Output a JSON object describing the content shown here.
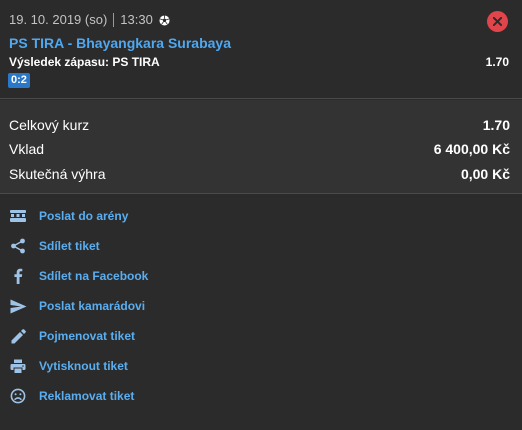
{
  "ticket": {
    "date": "19. 10. 2019 (so)",
    "time": "13:30",
    "match": "PS TIRA - Bhayangkara Surabaya",
    "result_label": "Výsledek zápasu: PS TIRA",
    "odds": "1.70",
    "score": "0:2"
  },
  "summary": {
    "total_odds_label": "Celkový kurz",
    "total_odds_value": "1.70",
    "stake_label": "Vklad",
    "stake_value": "6 400,00 Kč",
    "win_label": "Skutečná výhra",
    "win_value": "0,00 Kč"
  },
  "actions": [
    {
      "label": "Poslat do arény",
      "icon": "arena-icon"
    },
    {
      "label": "Sdílet tiket",
      "icon": "share-icon"
    },
    {
      "label": "Sdílet na Facebook",
      "icon": "facebook-icon"
    },
    {
      "label": "Poslat kamarádovi",
      "icon": "send-icon"
    },
    {
      "label": "Pojmenovat tiket",
      "icon": "pencil-icon"
    },
    {
      "label": "Vytisknout tiket",
      "icon": "print-icon"
    },
    {
      "label": "Reklamovat tiket",
      "icon": "sad-face-icon"
    }
  ],
  "colors": {
    "background": "#2b2b2b",
    "summary_background": "#333333",
    "link": "#5aaef0",
    "match_title": "#4fa8f0",
    "score_badge": "#2a78c8",
    "close_button": "#e0454b",
    "icon": "#9fc3e6"
  }
}
